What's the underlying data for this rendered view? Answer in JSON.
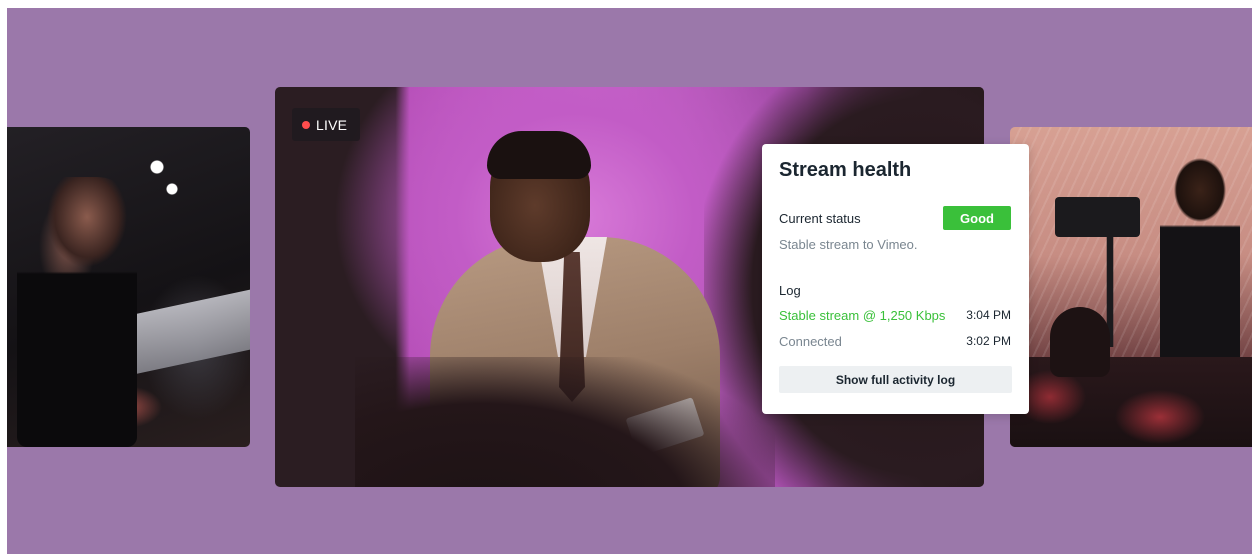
{
  "live_badge": {
    "label": "LIVE",
    "dot_color": "#ff4d4d"
  },
  "stream_health": {
    "title": "Stream health",
    "current_status_label": "Current status",
    "status_badge": "Good",
    "status_color": "#3ac03a",
    "status_description": "Stable stream to Vimeo.",
    "log_heading": "Log",
    "log_entries": [
      {
        "message": "Stable stream @ 1,250 Kbps",
        "time": "3:04 PM"
      },
      {
        "message": "Connected",
        "time": "3:02 PM"
      }
    ],
    "full_log_button": "Show full activity log"
  },
  "colors": {
    "background": "#9b78aa",
    "accent_green": "#3ac03a"
  }
}
